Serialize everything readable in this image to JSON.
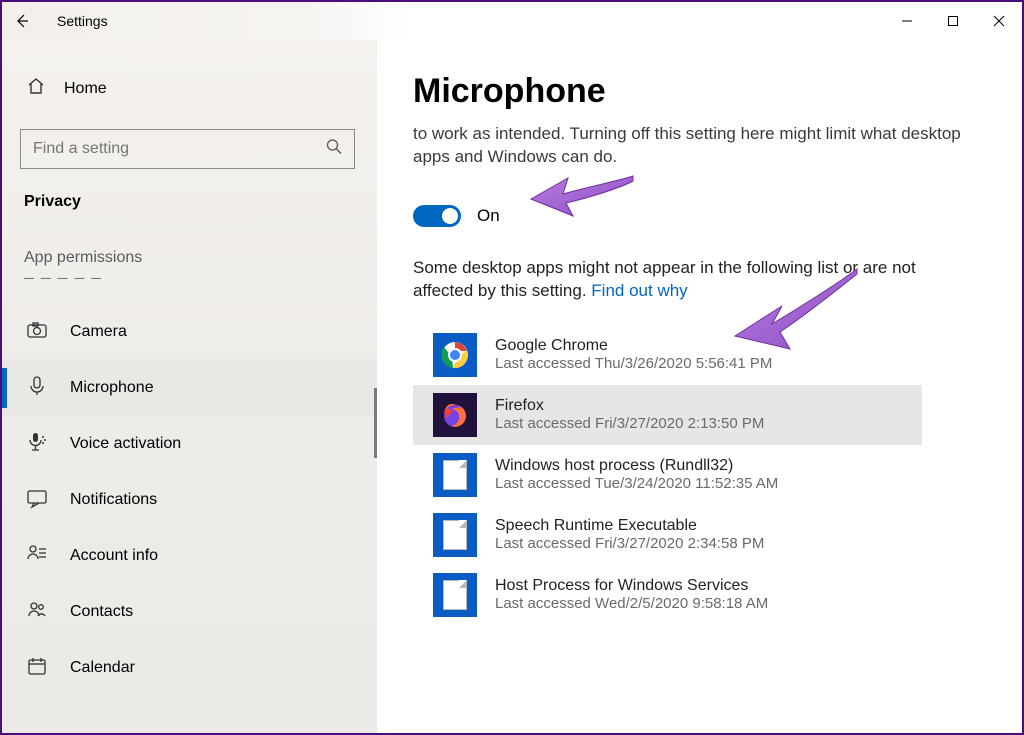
{
  "window": {
    "title": "Settings"
  },
  "sidebar": {
    "home": "Home",
    "search_placeholder": "Find a setting",
    "category": "Privacy",
    "subheader": "App permissions",
    "items": [
      {
        "label": "Camera"
      },
      {
        "label": "Microphone"
      },
      {
        "label": "Voice activation"
      },
      {
        "label": "Notifications"
      },
      {
        "label": "Account info"
      },
      {
        "label": "Contacts"
      },
      {
        "label": "Calendar"
      }
    ]
  },
  "main": {
    "title": "Microphone",
    "description": "to work as intended. Turning off this setting here might limit what desktop apps and Windows can do.",
    "toggle_state": "On",
    "note_prefix": "Some desktop apps might not appear in the following list or are not affected by this setting. ",
    "note_link": "Find out why",
    "apps": [
      {
        "name": "Google Chrome",
        "ts": "Last accessed Thu/3/26/2020 5:56:41 PM"
      },
      {
        "name": "Firefox",
        "ts": "Last accessed Fri/3/27/2020 2:13:50 PM"
      },
      {
        "name": "Windows host process (Rundll32)",
        "ts": "Last accessed Tue/3/24/2020 11:52:35 AM"
      },
      {
        "name": "Speech Runtime Executable",
        "ts": "Last accessed Fri/3/27/2020 2:34:58 PM"
      },
      {
        "name": "Host Process for Windows Services",
        "ts": "Last accessed Wed/2/5/2020 9:58:18 AM"
      }
    ]
  }
}
